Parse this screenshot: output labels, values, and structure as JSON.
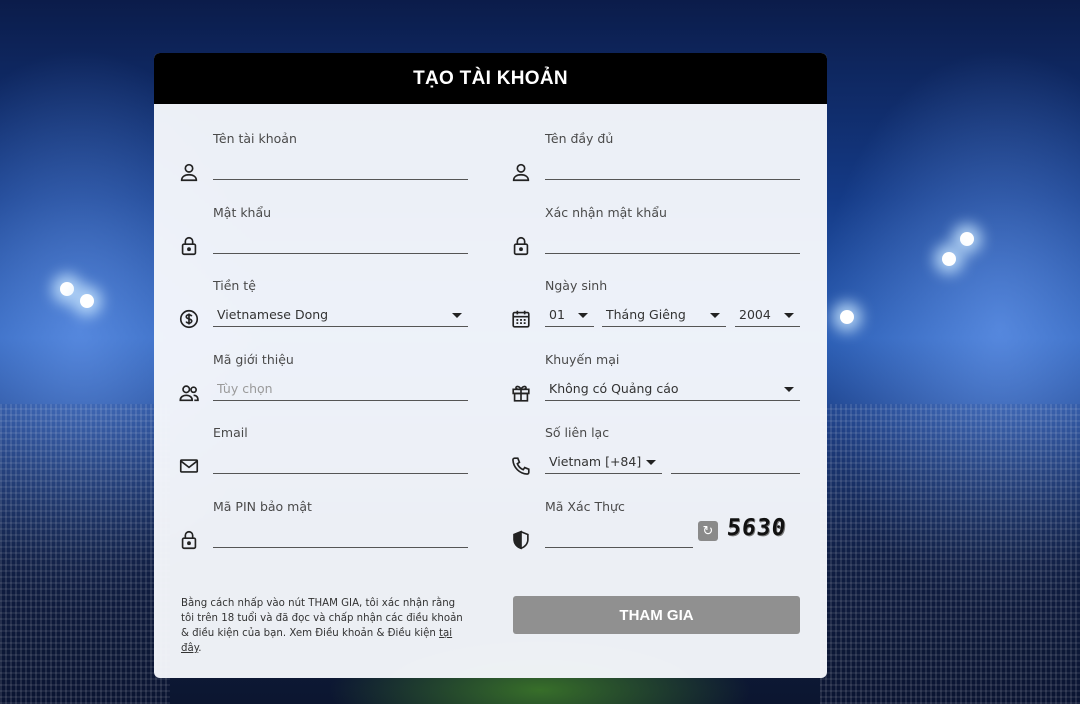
{
  "form": {
    "title": "TẠO TÀI KHOẢN",
    "username": {
      "label": "Tên tài khoản",
      "value": ""
    },
    "fullname": {
      "label": "Tên đầy đủ",
      "value": ""
    },
    "password": {
      "label": "Mật khẩu",
      "value": ""
    },
    "confirm_password": {
      "label": "Xác nhận mật khẩu",
      "value": ""
    },
    "currency": {
      "label": "Tiền tệ",
      "value": "Vietnamese Dong"
    },
    "birthday": {
      "label": "Ngày sinh",
      "day": "01",
      "month": "Tháng Giêng",
      "year": "2004"
    },
    "referral": {
      "label": "Mã giới thiệu",
      "placeholder": "Tùy chọn",
      "value": ""
    },
    "promotion": {
      "label": "Khuyến mại",
      "value": "Không có Quảng cáo"
    },
    "email": {
      "label": "Email",
      "value": ""
    },
    "phone": {
      "label": "Số liên lạc",
      "country": "Vietnam [+84]",
      "value": ""
    },
    "pin": {
      "label": "Mã PIN bảo mật",
      "value": ""
    },
    "captcha": {
      "label": "Mã Xác Thực",
      "value": "",
      "code": "5630"
    },
    "terms_text": "Bằng cách nhấp vào nút THAM GIA, tôi xác nhận rằng tôi trên 18 tuổi và đã đọc và chấp nhận các điều khoản & điều kiện của bạn. Xem Điều khoản & Điều kiện ",
    "terms_link": "tại đây",
    "terms_end": ".",
    "submit_label": "THAM GIA"
  },
  "icons": {
    "username": "user-icon",
    "fullname": "user-icon",
    "password": "lock-icon",
    "confirm_password": "lock-icon",
    "currency": "dollar-circle-icon",
    "birthday": "calendar-icon",
    "referral": "users-icon",
    "promotion": "gift-icon",
    "email": "envelope-icon",
    "phone": "phone-icon",
    "pin": "lock-icon",
    "captcha": "shield-icon",
    "refresh": "refresh-icon"
  },
  "colors": {
    "header_bg": "#000000",
    "card_bg": "#f6f8fc",
    "submit_bg": "#909090"
  }
}
